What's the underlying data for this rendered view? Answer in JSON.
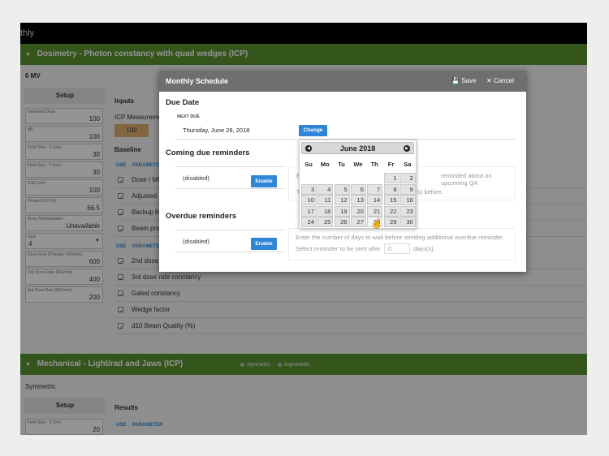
{
  "app": {
    "title_fragment": "thly"
  },
  "section1": {
    "title": "Dosimetry - Photon constancy with quad wedges (ICP)",
    "energy": "6 MV",
    "setup_label": "Setup",
    "inputs_label": "Inputs",
    "icp_label": "ICP Measureme",
    "icp_value": "100",
    "baseline_label": "Baseline",
    "fields": [
      {
        "label": "Delivered Dose",
        "value": "100"
      },
      {
        "label": "MU",
        "value": "100"
      },
      {
        "label": "Field Size - X (cm)",
        "value": "30"
      },
      {
        "label": "Field Size - Y (cm)",
        "value": "30"
      },
      {
        "label": "SSD (cm)",
        "value": "100"
      },
      {
        "label": "Photon D10 (%)",
        "value": "66.5"
      },
      {
        "label": "Array Normalization",
        "value": "Unavailable"
      },
      {
        "label": "Gain",
        "value": "4"
      },
      {
        "label": "Dose Rate (Primary) (MU/min)",
        "value": "600"
      },
      {
        "label": "2nd Dose Rate (MU/min)",
        "value": "400"
      },
      {
        "label": "3rd Dose Rate (MU/min)",
        "value": "200"
      }
    ],
    "param_headers": {
      "use": "USE",
      "parameter": "PARAMETER"
    },
    "params_group1": [
      "Dose / MU",
      "Adjusted D",
      "Backup M",
      "Beam prof"
    ],
    "params_group2": [
      "2nd dose",
      "3rd dose rate constancy",
      "Gated constancy",
      "Wedge factor",
      "d10 Beam Quality (%)"
    ]
  },
  "section2": {
    "title": "Mechanical - Light/rad and Jaws (ICP)",
    "options": [
      "Symmetric",
      "Asymmetric"
    ],
    "subtitle": "Symmetric",
    "setup_label": "Setup",
    "results_label": "Results",
    "field": {
      "label": "Field Size - X (cm)",
      "value": "20"
    },
    "param_headers": {
      "use": "USE",
      "parameter": "PARAMETER"
    }
  },
  "modal": {
    "title": "Monthly Schedule",
    "save_label": "Save",
    "cancel_label": "Cancel",
    "due_date": {
      "heading": "Due Date",
      "next_due_label": "NEXT DUE",
      "next_due_value": "Thursday, June 28, 2018",
      "change_label": "Change"
    },
    "coming_due": {
      "heading": "Coming due reminders",
      "status": "(disabled)",
      "enable_label": "Enable",
      "hint_fragment1": "E",
      "hint_fragment2": "reminded about an upcoming QA",
      "hint_fragment3": "T",
      "hint_fragment4": "ys(s) before."
    },
    "overdue": {
      "heading": "Overdue reminders",
      "status": "(disabled)",
      "enable_label": "Enable",
      "hint_line1": "Enter the number of days to wait before sending additional overdue reminder.",
      "hint_line2_pre": "Select reminder to be sent after",
      "hint_input_value": "0",
      "hint_line2_post": "days(s)."
    }
  },
  "calendar": {
    "title": "June 2018",
    "weekdays": [
      "Su",
      "Mo",
      "Tu",
      "We",
      "Th",
      "Fr",
      "Sa"
    ],
    "weeks": [
      [
        "",
        "",
        "",
        "",
        "",
        "1",
        "2"
      ],
      [
        "3",
        "4",
        "5",
        "6",
        "7",
        "8",
        "9"
      ],
      [
        "10",
        "11",
        "12",
        "13",
        "14",
        "15",
        "16"
      ],
      [
        "17",
        "18",
        "19",
        "20",
        "21",
        "22",
        "23"
      ],
      [
        "24",
        "25",
        "26",
        "27",
        "28",
        "29",
        "30"
      ]
    ],
    "selected": "28"
  }
}
